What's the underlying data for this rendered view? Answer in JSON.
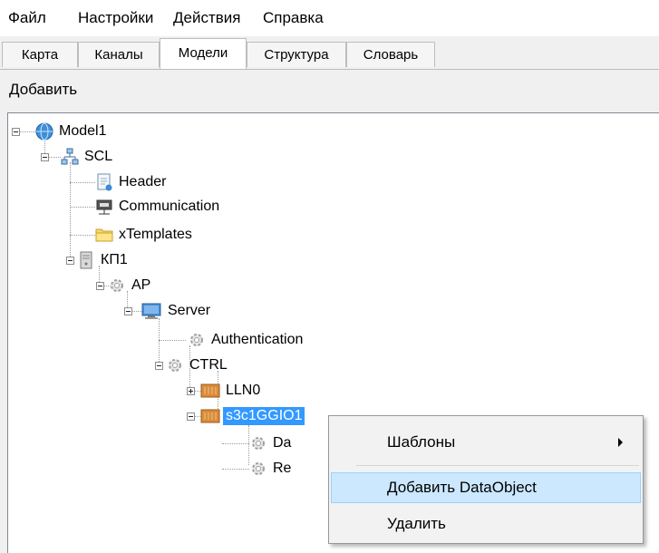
{
  "menu": [
    "Файл",
    "Настройки",
    "Действия",
    "Справка"
  ],
  "tabs": [
    {
      "label": "Карта",
      "active": false
    },
    {
      "label": "Каналы",
      "active": false
    },
    {
      "label": "Модели",
      "active": true
    },
    {
      "label": "Структура",
      "active": false
    },
    {
      "label": "Словарь",
      "active": false
    }
  ],
  "toolbar": {
    "add_label": "Добавить"
  },
  "tree": {
    "nodes": [
      {
        "label": "Model1",
        "icon": "globe-icon",
        "expanded": true
      },
      {
        "label": "SCL",
        "icon": "network-icon",
        "expanded": true
      },
      {
        "label": "Header",
        "icon": "document-icon"
      },
      {
        "label": "Communication",
        "icon": "network-port-icon"
      },
      {
        "label": "xTemplates",
        "icon": "folder-icon"
      },
      {
        "label": "КП1",
        "icon": "server-icon",
        "expanded": true
      },
      {
        "label": "AP",
        "icon": "gear-icon",
        "expanded": true
      },
      {
        "label": "Server",
        "icon": "monitor-icon",
        "expanded": true
      },
      {
        "label": "Authentication",
        "icon": "gear-icon"
      },
      {
        "label": "CTRL",
        "icon": "gear-icon",
        "expanded": true
      },
      {
        "label": "LLN0",
        "icon": "module-icon",
        "expanded": false
      },
      {
        "label": "s3c1GGIO1",
        "icon": "module-icon",
        "expanded": true,
        "selected": true
      },
      {
        "label": "Da",
        "icon": "gear-icon"
      },
      {
        "label": "Re",
        "icon": "gear-icon"
      }
    ]
  },
  "context_menu": {
    "items": [
      {
        "label": "Шаблоны",
        "submenu": true
      },
      {
        "label": "Добавить DataObject",
        "highlighted": true
      },
      {
        "label": "Удалить"
      }
    ]
  },
  "colors": {
    "selection": "#3399ff",
    "menu_highlight": "#cce8ff"
  }
}
